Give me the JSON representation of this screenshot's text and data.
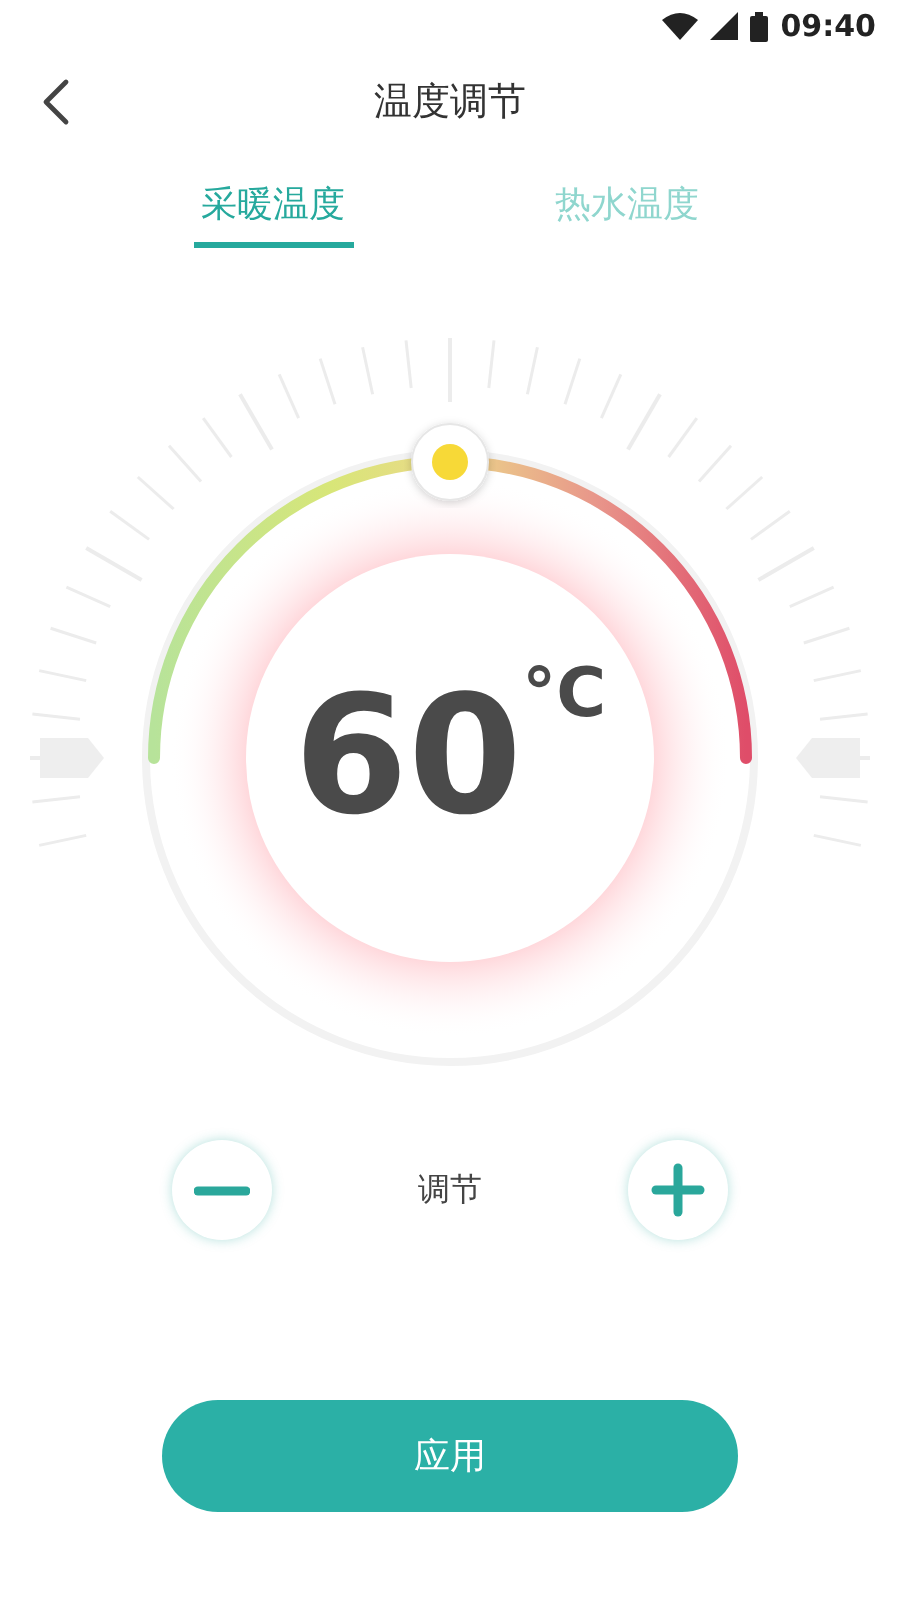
{
  "status_bar": {
    "time": "09:40"
  },
  "header": {
    "title": "温度调节"
  },
  "tabs": [
    {
      "label": "采暖温度",
      "selected": true
    },
    {
      "label": "热水温度",
      "selected": false
    }
  ],
  "dial": {
    "temperature": "60",
    "unit": "°C",
    "level": 0.5
  },
  "adjust": {
    "label": "调节"
  },
  "apply_button": {
    "label": "应用"
  }
}
